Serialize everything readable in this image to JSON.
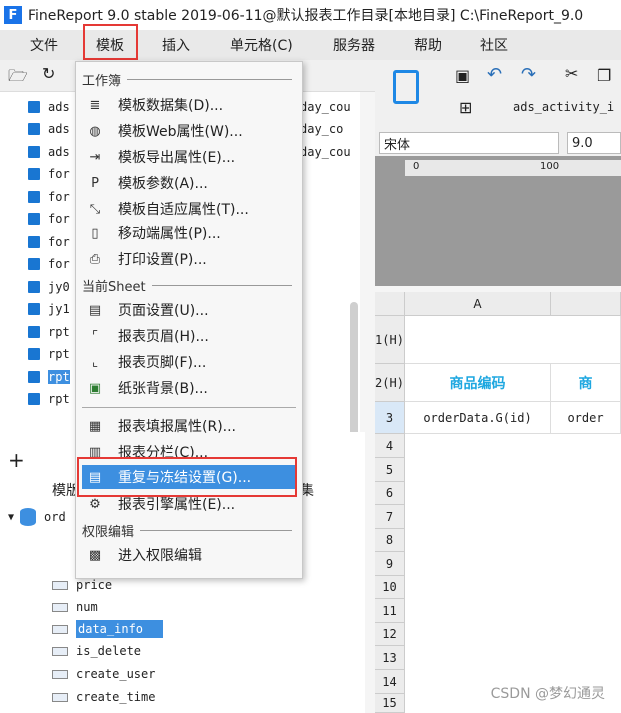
{
  "titlebar": {
    "logo": "F",
    "title": "FineReport 9.0 stable 2019-06-11@默认报表工作目录[本地目录]   C:\\FineReport_9.0"
  },
  "menubar": {
    "items": [
      "文件",
      "模板",
      "插入",
      "单元格(C)",
      "服务器",
      "帮助",
      "社区"
    ]
  },
  "tree": {
    "items": [
      "ads",
      "ads",
      "ads",
      "for",
      "for",
      "for",
      "for",
      "for",
      "jy0",
      "jy1",
      "rpt",
      "rpt",
      "rpt",
      "rpt"
    ],
    "right_items": [
      "day_cou",
      "day_co",
      "day_cou"
    ]
  },
  "lower_panel": {
    "tab_label": "模版",
    "tab_label_right": "集",
    "datasource": "ord",
    "fields": [
      "price",
      "num",
      "data_info",
      "is_delete",
      "create_user",
      "create_time"
    ],
    "selected_field": "data_info"
  },
  "font_bar": {
    "font": "宋体",
    "size": "9.0"
  },
  "toolbar": {
    "dataset_name": "ads_activity_i"
  },
  "ruler": {
    "mark0": "0",
    "mark100": "100"
  },
  "grid": {
    "col_a": "A",
    "rows": [
      "1(H)",
      "2(H)",
      "3",
      "4",
      "5",
      "6",
      "7",
      "8",
      "9",
      "10",
      "11",
      "12",
      "13",
      "14",
      "15"
    ],
    "header_cell": "商品编码",
    "header_cell_next": "商",
    "data_cell": "orderData.G(id)",
    "data_cell_next": "order"
  },
  "dropdown": {
    "section1": "工作簿",
    "section1_items": [
      {
        "icon": "database-icon",
        "glyph": "≣",
        "label": "模板数据集(D)..."
      },
      {
        "icon": "globe-icon",
        "glyph": "◍",
        "label": "模板Web属性(W)..."
      },
      {
        "icon": "export-icon",
        "glyph": "⇥",
        "label": "模板导出属性(E)..."
      },
      {
        "icon": "param-icon",
        "glyph": "P",
        "label": "模板参数(A)..."
      },
      {
        "icon": "resize-icon",
        "glyph": "⤡",
        "label": "模板自适应属性(T)..."
      },
      {
        "icon": "mobile-icon",
        "glyph": "▯",
        "label": "移动端属性(P)..."
      },
      {
        "icon": "printer-icon",
        "glyph": "⎙",
        "label": "打印设置(P)..."
      }
    ],
    "section2": "当前Sheet",
    "section2_items": [
      {
        "icon": "page-icon",
        "glyph": "▤",
        "label": "页面设置(U)..."
      },
      {
        "icon": "header-icon",
        "glyph": "⌜",
        "label": "报表页眉(H)..."
      },
      {
        "icon": "footer-icon",
        "glyph": "⌞",
        "label": "报表页脚(F)..."
      },
      {
        "icon": "image-icon",
        "glyph": "▣",
        "label": "纸张背景(B)..."
      }
    ],
    "section2b_items": [
      {
        "icon": "form-icon",
        "glyph": "▦",
        "label": "报表填报属性(R)..."
      },
      {
        "icon": "columns-icon",
        "glyph": "▥",
        "label": "报表分栏(C)..."
      },
      {
        "icon": "freeze-icon",
        "glyph": "▤",
        "label": "重复与冻结设置(G)..."
      },
      {
        "icon": "engine-icon",
        "glyph": "⚙",
        "label": "报表引擎属性(E)..."
      }
    ],
    "section3": "权限编辑",
    "section3_items": [
      {
        "icon": "permission-icon",
        "glyph": "▩",
        "label": "进入权限编辑"
      }
    ]
  },
  "watermark": "CSDN @梦幻通灵",
  "colors": {
    "highlight_red": "#e53935",
    "selection_blue": "#3d8fe0",
    "cell_header": "#1ea7e0"
  }
}
